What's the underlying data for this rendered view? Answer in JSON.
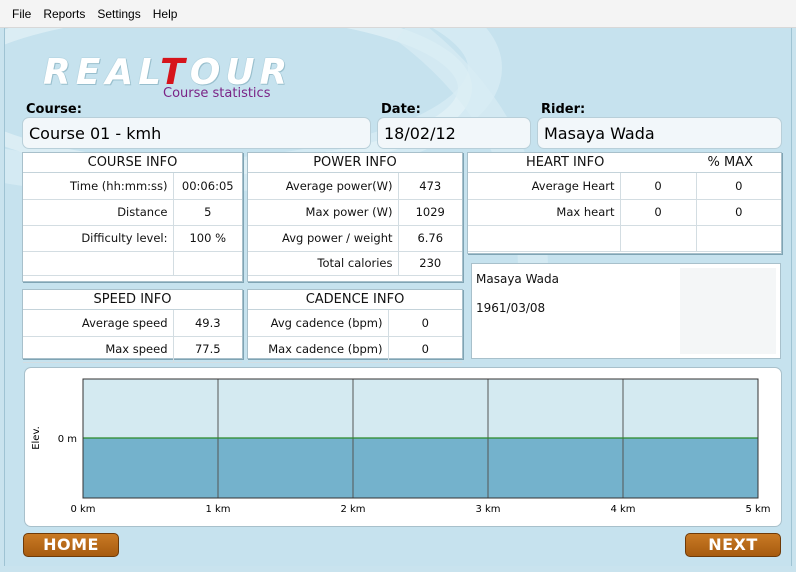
{
  "menu": [
    "File",
    "Reports",
    "Settings",
    "Help"
  ],
  "logo": {
    "text_a": "REAL",
    "text_t": "T",
    "text_b": "OUR",
    "subtitle": "Course statistics"
  },
  "fields": {
    "course_label": "Course:",
    "course_value": "Course 01 - kmh",
    "date_label": "Date:",
    "date_value": "18/02/12",
    "rider_label": "Rider:",
    "rider_value": "Masaya Wada"
  },
  "course_info": {
    "title": "COURSE INFO",
    "rows": [
      {
        "label": "Time (hh:mm:ss)",
        "value": "00:06:05"
      },
      {
        "label": "Distance",
        "value": "5"
      },
      {
        "label": "Difficulty level:",
        "value": "100 %"
      },
      {
        "label": "",
        "value": ""
      }
    ]
  },
  "power_info": {
    "title": "POWER INFO",
    "rows": [
      {
        "label": "Average power(W)",
        "value": "473"
      },
      {
        "label": "Max power (W)",
        "value": "1029"
      },
      {
        "label": "Avg power / weight",
        "value": "6.76"
      },
      {
        "label": "Total calories",
        "value": "230"
      }
    ]
  },
  "heart_info": {
    "title": "HEART INFO",
    "pct_title": "% MAX",
    "rows": [
      {
        "label": "Average Heart",
        "value": "0",
        "pct": "0"
      },
      {
        "label": "Max heart",
        "value": "0",
        "pct": "0"
      },
      {
        "label": "",
        "value": "",
        "pct": ""
      }
    ]
  },
  "speed_info": {
    "title": "SPEED INFO",
    "rows": [
      {
        "label": "Average speed",
        "value": "49.3"
      },
      {
        "label": "Max speed",
        "value": "77.5"
      }
    ]
  },
  "cadence_info": {
    "title": "CADENCE INFO",
    "rows": [
      {
        "label": "Avg cadence (bpm)",
        "value": "0"
      },
      {
        "label": "Max cadence (bpm)",
        "value": "0"
      }
    ]
  },
  "rider_card": {
    "name": "Masaya Wada",
    "birthdate": "1961/03/08"
  },
  "chart_data": {
    "type": "area",
    "ylabel": "Elev.",
    "xlabel": "",
    "x_ticks": [
      "0 km",
      "1 km",
      "2 km",
      "3 km",
      "4 km",
      "5 km"
    ],
    "xlim": [
      0,
      5
    ],
    "y_tick": "0 m",
    "x": [
      0,
      5
    ],
    "y": [
      0,
      0
    ],
    "fill_color": "#74b2cc",
    "line_color": "#2a8a2a",
    "bg_color": "#d4eaf1"
  },
  "buttons": {
    "home": "HOME",
    "next": "NEXT"
  },
  "colors": {
    "accent": "#d6141b",
    "button": "#b86a18",
    "subtitle": "#7a2486"
  }
}
